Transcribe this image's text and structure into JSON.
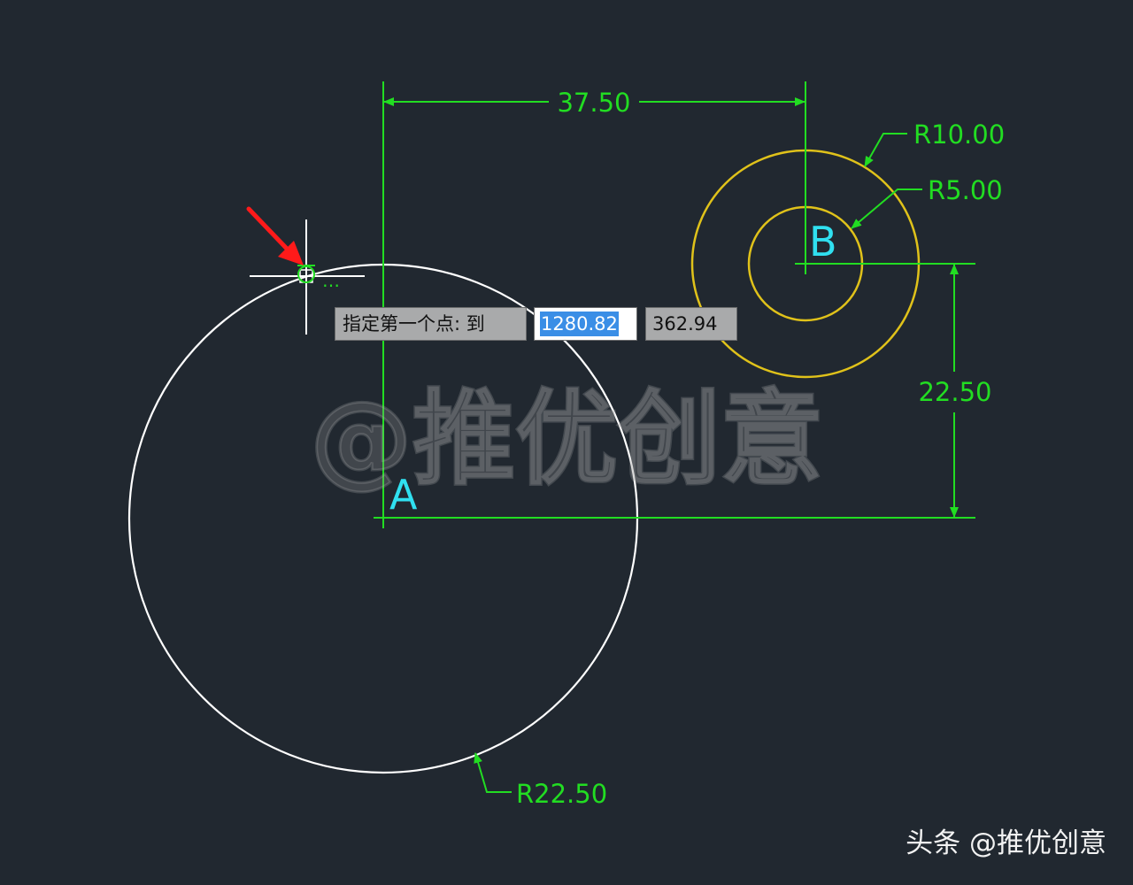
{
  "drawing": {
    "dimensions": {
      "horizontal": "37.50",
      "vertical": "22.50",
      "radius_outer_b": "R10.00",
      "radius_inner_b": "R5.00",
      "radius_a": "R22.50"
    },
    "points": {
      "a": "A",
      "b": "B"
    },
    "watermark": "@推优创意"
  },
  "dynamic_input": {
    "prompt": "指定第一个点: 到",
    "x_value": "1280.82",
    "y_value": "362.94"
  },
  "cursor": {
    "snap_marker": "…"
  },
  "credit": "头条 @推优创意",
  "colors": {
    "background": "#212830",
    "dimension": "#22dd22",
    "circle_a": "#ffffff",
    "circles_b": "#e0c21a",
    "point_label": "#30e0f0",
    "arrow": "#ff1a1a"
  },
  "icons": {
    "cursor": "crosshair-icon",
    "snap": "tangent-snap-icon",
    "pointer": "red-arrow-icon"
  }
}
